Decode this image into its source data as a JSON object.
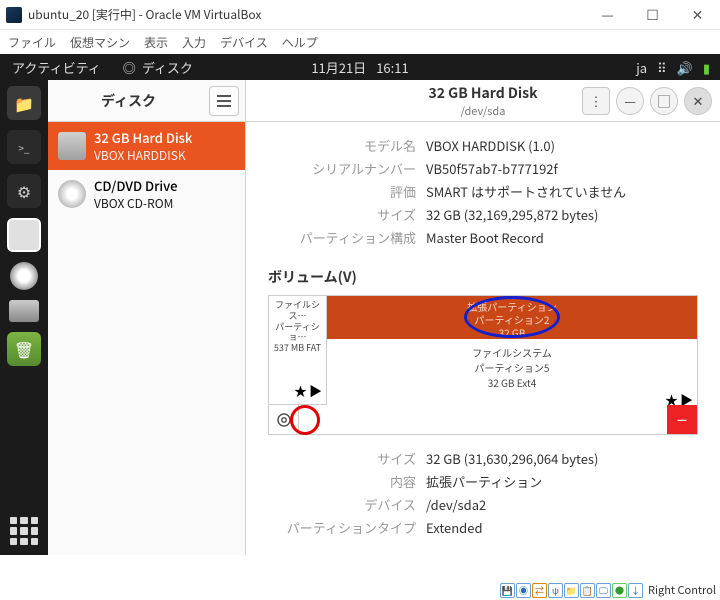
{
  "window": {
    "title": "ubuntu_20 [実行中] - Oracle VM VirtualBox"
  },
  "menubar": {
    "file": "ファイル",
    "machine": "仮想マシン",
    "view": "表示",
    "input": "入力",
    "device": "デバイス",
    "help": "ヘルプ"
  },
  "topbar": {
    "activities": "アクティビティ",
    "app": "ディスク",
    "date": "11月21日",
    "time": "16:11",
    "lang": "ja"
  },
  "sidebar": {
    "title": "ディスク",
    "items": [
      {
        "l1": "32 GB Hard Disk",
        "l2": "VBOX HARDDISK"
      },
      {
        "l1": "CD/DVD Drive",
        "l2": "VBOX CD-ROM"
      }
    ]
  },
  "detail": {
    "title": "32 GB Hard Disk",
    "subtitle": "/dev/sda"
  },
  "info": {
    "model_label": "モデル名",
    "model_value": "VBOX HARDDISK (1.0)",
    "serial_label": "シリアルナンバー",
    "serial_value": "VB50f57ab7-b777192f",
    "assess_label": "評価",
    "assess_value": "SMART はサポートされていません",
    "size_label": "サイズ",
    "size_value": "32 GB (32,169,295,872 bytes)",
    "part_label": "パーティション構成",
    "part_value": "Master Boot Record"
  },
  "volumes": {
    "title": "ボリューム(V)",
    "small": {
      "l1": "ファイルシス…",
      "l2": "パーティショ…",
      "l3": "537 MB FAT"
    },
    "big_top": {
      "l1": "拡張パーティション",
      "l2": "パーティション2",
      "l3": "32 GB"
    },
    "big_bottom": {
      "l1": "ファイルシステム",
      "l2": "パーティション5",
      "l3": "32 GB Ext4"
    }
  },
  "partition": {
    "size_label": "サイズ",
    "size_value": "32 GB (31,630,296,064 bytes)",
    "content_label": "内容",
    "content_value": "拡張パーティション",
    "device_label": "デバイス",
    "device_value": "/dev/sda2",
    "type_label": "パーティションタイプ",
    "type_value": "Extended"
  },
  "statusbar": {
    "rc": "Right Control"
  }
}
